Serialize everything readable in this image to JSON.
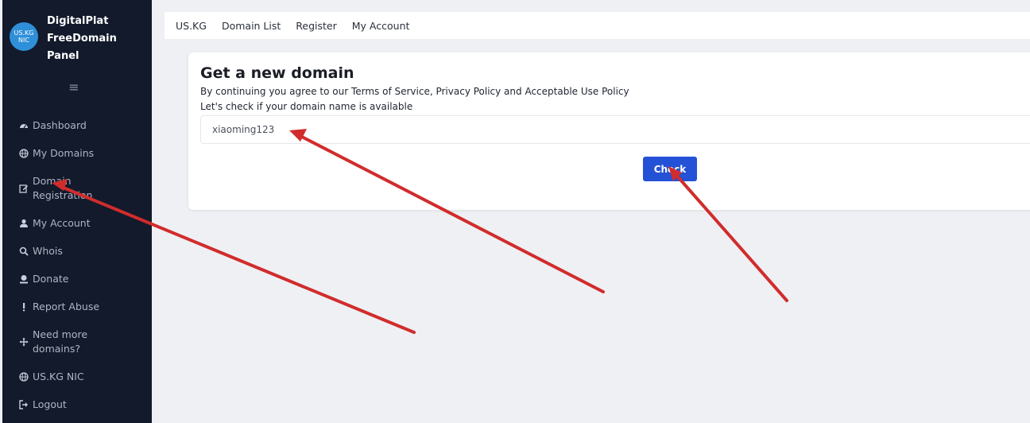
{
  "sidebar": {
    "brand_logo_line1": "US.KG",
    "brand_logo_line2": "NIC",
    "brand_title_line1": "DigitalPlat",
    "brand_title_line2": "FreeDomain",
    "brand_title_line3": "Panel",
    "menu_toggle": "≡",
    "items": [
      {
        "label": "Dashboard",
        "icon": "dashboard-icon"
      },
      {
        "label_line1": "My Domains",
        "icon": "globe-icon"
      },
      {
        "label_line1": "Domain",
        "label_line2": "Registration",
        "icon": "edit-icon"
      },
      {
        "label": "My Account",
        "icon": "user-icon"
      },
      {
        "label": "Whois",
        "icon": "search-icon"
      },
      {
        "label": "Donate",
        "icon": "donate-icon"
      },
      {
        "label": "Report Abuse",
        "icon": "exclamation-icon"
      },
      {
        "label_line1": "Need more",
        "label_line2": "domains?",
        "icon": "move-icon"
      },
      {
        "label": "US.KG NIC",
        "icon": "globe-icon"
      },
      {
        "label": "Logout",
        "icon": "logout-icon"
      }
    ]
  },
  "topbar": {
    "links": [
      "US.KG",
      "Domain List",
      "Register",
      "My Account"
    ]
  },
  "main": {
    "title": "Get a new domain",
    "terms_text": "By continuing you agree to our Terms of Service, Privacy Policy and Acceptable Use Policy",
    "check_text": "Let's check if your domain name is available",
    "domain_input_value": "xiaoming123",
    "check_button_label": "Check"
  },
  "colors": {
    "sidebar_bg": "#121a2b",
    "accent": "#2452d6",
    "annotation_arrow": "#d12c2c"
  }
}
